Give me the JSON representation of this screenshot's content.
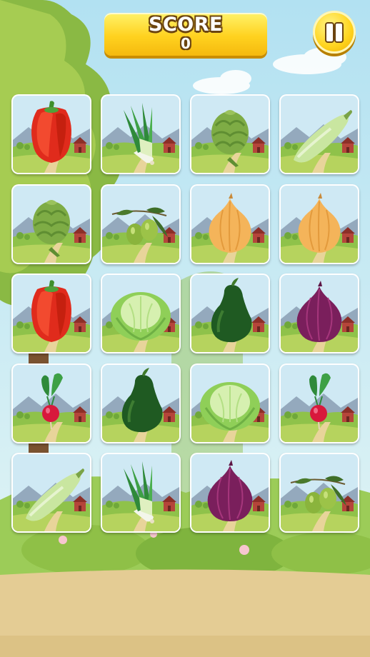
{
  "hud": {
    "score_label": "SCORE",
    "score_value": "0",
    "pause_icon": "pause-icon"
  },
  "colors": {
    "sky": "#bfe6f4",
    "ground": "#e3cb93",
    "grass": "#a7cf52",
    "score_bg": "#ffd21f",
    "outline": "#6b4410"
  },
  "cards": [
    {
      "veg": "bell-pepper",
      "row": 0,
      "col": 0
    },
    {
      "veg": "leek",
      "row": 0,
      "col": 1
    },
    {
      "veg": "artichoke",
      "row": 0,
      "col": 2
    },
    {
      "veg": "zucchini",
      "row": 0,
      "col": 3
    },
    {
      "veg": "artichoke",
      "row": 1,
      "col": 0
    },
    {
      "veg": "olives",
      "row": 1,
      "col": 1
    },
    {
      "veg": "onion",
      "row": 1,
      "col": 2
    },
    {
      "veg": "onion",
      "row": 1,
      "col": 3
    },
    {
      "veg": "bell-pepper",
      "row": 2,
      "col": 0
    },
    {
      "veg": "cabbage",
      "row": 2,
      "col": 1
    },
    {
      "veg": "avocado",
      "row": 2,
      "col": 2
    },
    {
      "veg": "red-onion",
      "row": 2,
      "col": 3
    },
    {
      "veg": "radish",
      "row": 3,
      "col": 0
    },
    {
      "veg": "avocado",
      "row": 3,
      "col": 1
    },
    {
      "veg": "cabbage",
      "row": 3,
      "col": 2
    },
    {
      "veg": "radish",
      "row": 3,
      "col": 3
    },
    {
      "veg": "zucchini",
      "row": 4,
      "col": 0
    },
    {
      "veg": "leek",
      "row": 4,
      "col": 1
    },
    {
      "veg": "red-onion",
      "row": 4,
      "col": 2
    },
    {
      "veg": "olives",
      "row": 4,
      "col": 3
    }
  ]
}
